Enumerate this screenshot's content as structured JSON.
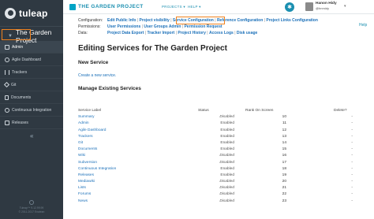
{
  "sidebar": {
    "brand": "tuleap",
    "project": "The Garden Project",
    "items": [
      {
        "label": "Admin",
        "icon": "admin-icon"
      },
      {
        "label": "Agile Dashboard",
        "icon": "agile-icon"
      },
      {
        "label": "Trackers",
        "icon": "trackers-icon"
      },
      {
        "label": "Git",
        "icon": "git-icon"
      },
      {
        "label": "Documents",
        "icon": "documents-icon"
      },
      {
        "label": "Continuous Integration",
        "icon": "ci-icon"
      },
      {
        "label": "Releases",
        "icon": "releases-icon"
      }
    ],
    "collapse": "«",
    "footer_line1": "Tuleap™ 9.12.99.99",
    "footer_line2": "© 2011-2017 Enalean"
  },
  "topnav": {
    "project_name": "THE GARDEN PROJECT",
    "projects_menu": "PROJECTS ▾",
    "help_menu": "HELP ▾",
    "user_name": "Hanon Hidy",
    "user_handle": "@hnmidy",
    "user_menu": "▾",
    "help_link": "Help"
  },
  "admin_nav": {
    "row1_label": "Configuration:",
    "row1_links": [
      "Edit Public Info",
      "Project visibility",
      "Service Configuration",
      "Reference Configuration",
      "Project Links Configuration"
    ],
    "row2_label": "Permissions:",
    "row2_links": [
      "User Permissions",
      "User Groups Admin",
      "Permission Request"
    ],
    "row3_label": "Data:",
    "row3_links": [
      "Project Data Export",
      "Tracker Import",
      "Project History",
      "Access Logs",
      "Disk usage"
    ]
  },
  "page": {
    "title": "Editing Services for The Garden Project",
    "new_service_heading": "New Service",
    "create_link": "Create a new service.",
    "manage_heading": "Manage Existing Services"
  },
  "table": {
    "headers": [
      "Service Label",
      "Status",
      "Rank On Screen",
      "Delete?"
    ],
    "rows": [
      {
        "label": "Summary",
        "status": "Disabled",
        "rank": "10",
        "delete": "-"
      },
      {
        "label": "Admin",
        "status": "Enabled",
        "rank": "11",
        "delete": "-"
      },
      {
        "label": "Agile Dashboard",
        "status": "Enabled",
        "rank": "12",
        "delete": "-"
      },
      {
        "label": "Trackers",
        "status": "Enabled",
        "rank": "13",
        "delete": "-"
      },
      {
        "label": "Git",
        "status": "Enabled",
        "rank": "14",
        "delete": "-"
      },
      {
        "label": "Documents",
        "status": "Enabled",
        "rank": "15",
        "delete": "-"
      },
      {
        "label": "Wiki",
        "status": "Disabled",
        "rank": "16",
        "delete": "-"
      },
      {
        "label": "Subversion",
        "status": "Disabled",
        "rank": "17",
        "delete": "-"
      },
      {
        "label": "Continuous Integration",
        "status": "Enabled",
        "rank": "18",
        "delete": "-"
      },
      {
        "label": "Releases",
        "status": "Enabled",
        "rank": "19",
        "delete": "-"
      },
      {
        "label": "Mediawiki",
        "status": "Disabled",
        "rank": "20",
        "delete": "-"
      },
      {
        "label": "Lists",
        "status": "Disabled",
        "rank": "21",
        "delete": "-"
      },
      {
        "label": "Forums",
        "status": "Disabled",
        "rank": "22",
        "delete": "-"
      },
      {
        "label": "News",
        "status": "Disabled",
        "rank": "23",
        "delete": "-"
      }
    ]
  },
  "colors": {
    "sidebar_bg": "#2f3942",
    "accent": "#1b8fb0",
    "link": "#1b70b9",
    "highlight": "#f0821e"
  }
}
